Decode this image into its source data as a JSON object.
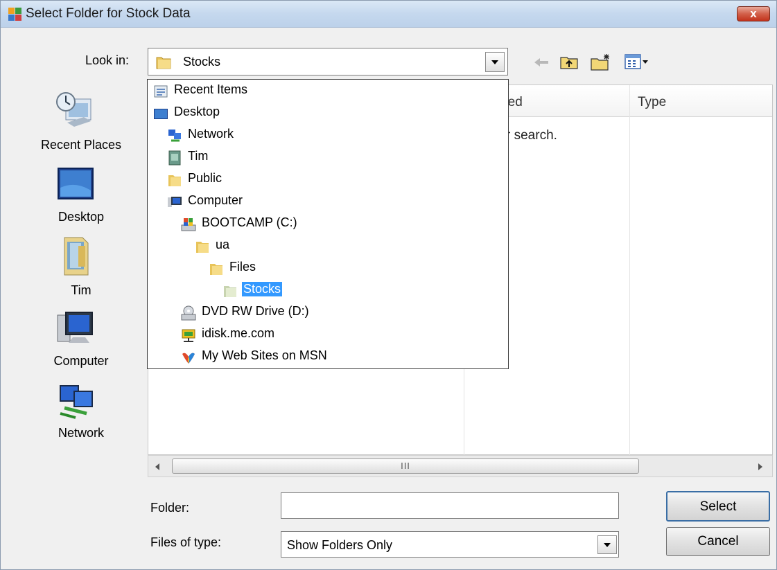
{
  "window": {
    "title": "Select Folder for Stock Data",
    "close_label": "x"
  },
  "look_in": {
    "label": "Look in:",
    "value": "Stocks"
  },
  "places": [
    {
      "label": "Recent Places",
      "icon": "recent-places-icon"
    },
    {
      "label": "Desktop",
      "icon": "desktop-icon"
    },
    {
      "label": "Tim",
      "icon": "user-folder-icon"
    },
    {
      "label": "Computer",
      "icon": "computer-icon"
    },
    {
      "label": "Network",
      "icon": "network-icon"
    }
  ],
  "columns": {
    "date_modified": "modified",
    "type": "Type"
  },
  "empty_message": "r search.",
  "dropdown": [
    {
      "label": "Recent Items",
      "icon": "recent-items-icon",
      "level": 0
    },
    {
      "label": "Desktop",
      "icon": "desktop-icon",
      "level": 0
    },
    {
      "label": "Network",
      "icon": "network-icon",
      "level": 1
    },
    {
      "label": "Tim",
      "icon": "user-icon",
      "level": 1
    },
    {
      "label": "Public",
      "icon": "folder-icon",
      "level": 1
    },
    {
      "label": "Computer",
      "icon": "computer-icon",
      "level": 1
    },
    {
      "label": "BOOTCAMP (C:)",
      "icon": "drive-icon",
      "level": 2
    },
    {
      "label": "ua",
      "icon": "folder-icon",
      "level": 3
    },
    {
      "label": "Files",
      "icon": "folder-icon",
      "level": 4
    },
    {
      "label": "Stocks",
      "icon": "folder-open-icon",
      "level": 5,
      "selected": true
    },
    {
      "label": "DVD RW Drive (D:)",
      "icon": "dvd-drive-icon",
      "level": 2
    },
    {
      "label": "idisk.me.com",
      "icon": "network-drive-icon",
      "level": 2
    },
    {
      "label": "My Web Sites on MSN",
      "icon": "msn-icon",
      "level": 2
    }
  ],
  "scrollbar": {
    "thumb_grip": "III"
  },
  "folder": {
    "label": "Folder:",
    "value": ""
  },
  "files_of_type": {
    "label": "Files of type:",
    "value": "Show Folders Only"
  },
  "buttons": {
    "select": "Select",
    "cancel": "Cancel"
  },
  "colors": {
    "selection": "#3399ff",
    "titlebar": "#c5d8ee",
    "close": "#c2331c"
  }
}
